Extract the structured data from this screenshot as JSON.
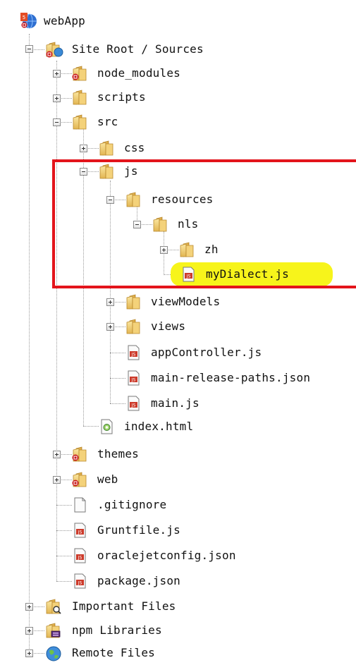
{
  "tree": {
    "root": {
      "label": "webApp",
      "icon": "html5-project-icon"
    },
    "site_root": {
      "label": "Site Root / Sources",
      "icon": "web-folder-icon"
    },
    "node_modules": {
      "label": "node_modules",
      "icon": "library-folder-icon"
    },
    "scripts": {
      "label": "scripts",
      "icon": "folder-icon"
    },
    "src": {
      "label": "src",
      "icon": "folder-icon"
    },
    "css": {
      "label": "css",
      "icon": "folder-icon"
    },
    "js": {
      "label": "js",
      "icon": "folder-icon"
    },
    "resources": {
      "label": "resources",
      "icon": "folder-icon"
    },
    "nls": {
      "label": "nls",
      "icon": "folder-icon"
    },
    "zh": {
      "label": "zh",
      "icon": "folder-icon"
    },
    "myDialect": {
      "label": "myDialect.js",
      "icon": "js-file-icon",
      "highlighted": true,
      "highlight_color": "#f7f41b"
    },
    "viewModels": {
      "label": "viewModels",
      "icon": "folder-icon"
    },
    "views": {
      "label": "views",
      "icon": "folder-icon"
    },
    "appController": {
      "label": "appController.js",
      "icon": "js-file-icon"
    },
    "main_release_paths": {
      "label": "main-release-paths.json",
      "icon": "js-file-icon"
    },
    "main_js": {
      "label": "main.js",
      "icon": "js-file-icon"
    },
    "index_html": {
      "label": "index.html",
      "icon": "html-file-icon"
    },
    "themes": {
      "label": "themes",
      "icon": "library-folder-icon"
    },
    "web": {
      "label": "web",
      "icon": "library-folder-icon"
    },
    "gitignore": {
      "label": ".gitignore",
      "icon": "file-icon"
    },
    "gruntfile": {
      "label": "Gruntfile.js",
      "icon": "js-file-icon"
    },
    "oraclejetconfig": {
      "label": "oraclejetconfig.json",
      "icon": "js-file-icon"
    },
    "package_json": {
      "label": "package.json",
      "icon": "js-file-icon"
    },
    "important_files": {
      "label": "Important Files",
      "icon": "important-files-icon"
    },
    "npm_libraries": {
      "label": "npm Libraries",
      "icon": "npm-libraries-icon"
    },
    "remote_files": {
      "label": "Remote Files",
      "icon": "globe-icon"
    }
  },
  "annotation": {
    "color": "#e3141b"
  }
}
